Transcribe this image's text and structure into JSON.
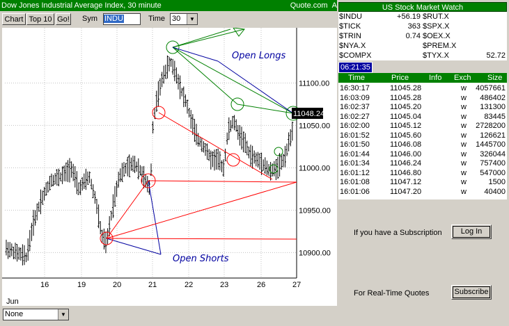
{
  "window": {
    "title": "Dow Jones Industrial Average Index, 30 minute",
    "source": "Quote.com",
    "source_suffix": "A"
  },
  "toolbar": {
    "chart_label": "Chart",
    "top10_label": "Top 10",
    "go_label": "Go!",
    "sym_label": "Sym",
    "sym_value": "INDU",
    "time_label": "Time",
    "time_value": "30"
  },
  "chart": {
    "price_marker": "11048.24",
    "y_ticks": [
      "11100.00",
      "11050.00",
      "11000.00",
      "10950.00",
      "10900.00"
    ],
    "x_ticks": [
      "16",
      "19",
      "20",
      "21",
      "22",
      "23",
      "26",
      "27"
    ],
    "month_label": "Jun",
    "annotation_longs": "Open Longs",
    "annotation_shorts": "Open Shorts"
  },
  "chart_data": {
    "type": "bar",
    "title": "Dow Jones Industrial Average Index, 30 minute",
    "xlabel": "",
    "ylabel": "",
    "ylim": [
      10870,
      11165
    ],
    "x_categories": [
      "16",
      "19",
      "20",
      "21",
      "22",
      "23",
      "26",
      "27"
    ],
    "last_price": 11048.24,
    "bar_style": "OHLC",
    "colors": {
      "bars": "#000000",
      "longs": "#008000",
      "shorts": "#ff0000",
      "trend": "#0000a0"
    }
  },
  "bottom": {
    "select_value": "None"
  },
  "market_watch": {
    "title": "US Stock Market Watch",
    "rows": [
      {
        "sym1": "$INDU",
        "val1": "+56.19",
        "sym2": "$RUT.X",
        "val2": ""
      },
      {
        "sym1": "$TICK",
        "val1": "363",
        "sym2": "$SPX.X",
        "val2": ""
      },
      {
        "sym1": "$TRIN",
        "val1": "0.74",
        "sym2": "$OEX.X",
        "val2": ""
      },
      {
        "sym1": "$NYA.X",
        "val1": "",
        "sym2": "$PREM.X",
        "val2": ""
      },
      {
        "sym1": "$COMPX",
        "val1": "",
        "sym2": "$TYX.X",
        "val2": "52.72"
      }
    ]
  },
  "clock": "06:21:35",
  "trades": {
    "headers": [
      "Time",
      "Price",
      "Info",
      "Exch",
      "Size"
    ],
    "rows": [
      [
        "16:30:17",
        "11045.28",
        "",
        "w",
        "4057661"
      ],
      [
        "16:03:09",
        "11045.28",
        "",
        "w",
        "486402"
      ],
      [
        "16:02:37",
        "11045.20",
        "",
        "w",
        "131300"
      ],
      [
        "16:02:27",
        "11045.04",
        "",
        "w",
        "83445"
      ],
      [
        "16:02:00",
        "11045.12",
        "",
        "w",
        "2728200"
      ],
      [
        "16:01:52",
        "11045.60",
        "",
        "w",
        "126621"
      ],
      [
        "16:01:50",
        "11046.08",
        "",
        "w",
        "1445700"
      ],
      [
        "16:01:44",
        "11046.00",
        "",
        "w",
        "326044"
      ],
      [
        "16:01:34",
        "11046.24",
        "",
        "w",
        "757400"
      ],
      [
        "16:01:12",
        "11046.80",
        "",
        "w",
        "547000"
      ],
      [
        "16:01:08",
        "11047.12",
        "",
        "w",
        "1500"
      ],
      [
        "16:01:06",
        "11047.20",
        "",
        "w",
        "40400"
      ]
    ]
  },
  "subscription": {
    "text1": "If you have a Subscription",
    "login_label": "Log In",
    "text2": "For Real-Time Quotes",
    "subscribe_label": "Subscribe"
  }
}
